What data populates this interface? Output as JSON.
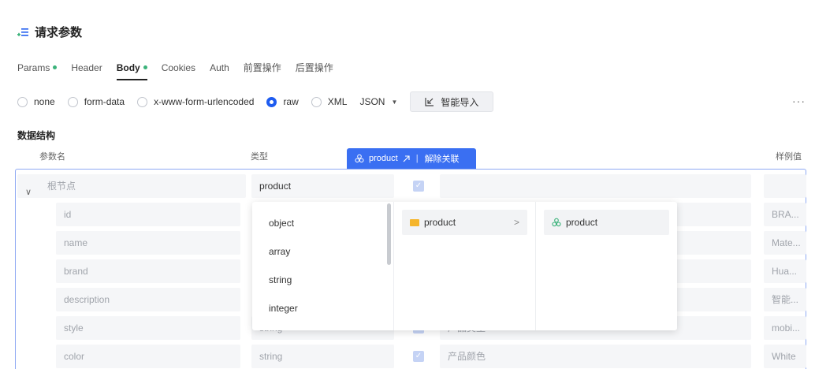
{
  "section": {
    "title": "请求参数",
    "icon": "list-add-icon"
  },
  "tabs": [
    {
      "label": "Params",
      "dot": true,
      "active": false
    },
    {
      "label": "Header",
      "dot": false,
      "active": false
    },
    {
      "label": "Body",
      "dot": true,
      "active": true
    },
    {
      "label": "Cookies",
      "dot": false,
      "active": false
    },
    {
      "label": "Auth",
      "dot": false,
      "active": false
    },
    {
      "label": "前置操作",
      "dot": false,
      "active": false
    },
    {
      "label": "后置操作",
      "dot": false,
      "active": false
    }
  ],
  "body_types": [
    {
      "label": "none",
      "checked": false
    },
    {
      "label": "form-data",
      "checked": false
    },
    {
      "label": "x-www-form-urlencoded",
      "checked": false
    },
    {
      "label": "raw",
      "checked": true
    },
    {
      "label": "XML",
      "checked": false
    }
  ],
  "format_select": {
    "value": "JSON"
  },
  "import_button": {
    "label": "智能导入",
    "icon": "import-icon"
  },
  "more_button": {
    "label": "···"
  },
  "data_structure": {
    "title": "数据结构",
    "columns": {
      "name": "参数名",
      "type": "类型",
      "example": "样例值"
    },
    "link_banner": {
      "model": "product",
      "unlink": "解除关联"
    },
    "root": {
      "label": "根节点",
      "type": "product"
    },
    "rows": [
      {
        "name": "id",
        "type": "",
        "desc": "",
        "example": "BRA..."
      },
      {
        "name": "name",
        "type": "",
        "desc": "",
        "example": "Mate..."
      },
      {
        "name": "brand",
        "type": "",
        "desc": "",
        "example": "Hua..."
      },
      {
        "name": "description",
        "type": "",
        "desc": "",
        "example": "智能..."
      },
      {
        "name": "style",
        "type": "string",
        "desc": "产品类型",
        "example": "mobi..."
      },
      {
        "name": "color",
        "type": "string",
        "desc": "产品颜色",
        "example": "White"
      }
    ]
  },
  "type_dropdown": {
    "options": [
      "object",
      "array",
      "string",
      "integer"
    ],
    "folder": {
      "label": "product"
    },
    "model": {
      "label": "product"
    }
  },
  "colors": {
    "accent": "#3a6ff2",
    "radio_checked": "#1e5cf0",
    "dot": "#3bb27a",
    "folder": "#f5b52c",
    "cube": "#3bb27a"
  }
}
